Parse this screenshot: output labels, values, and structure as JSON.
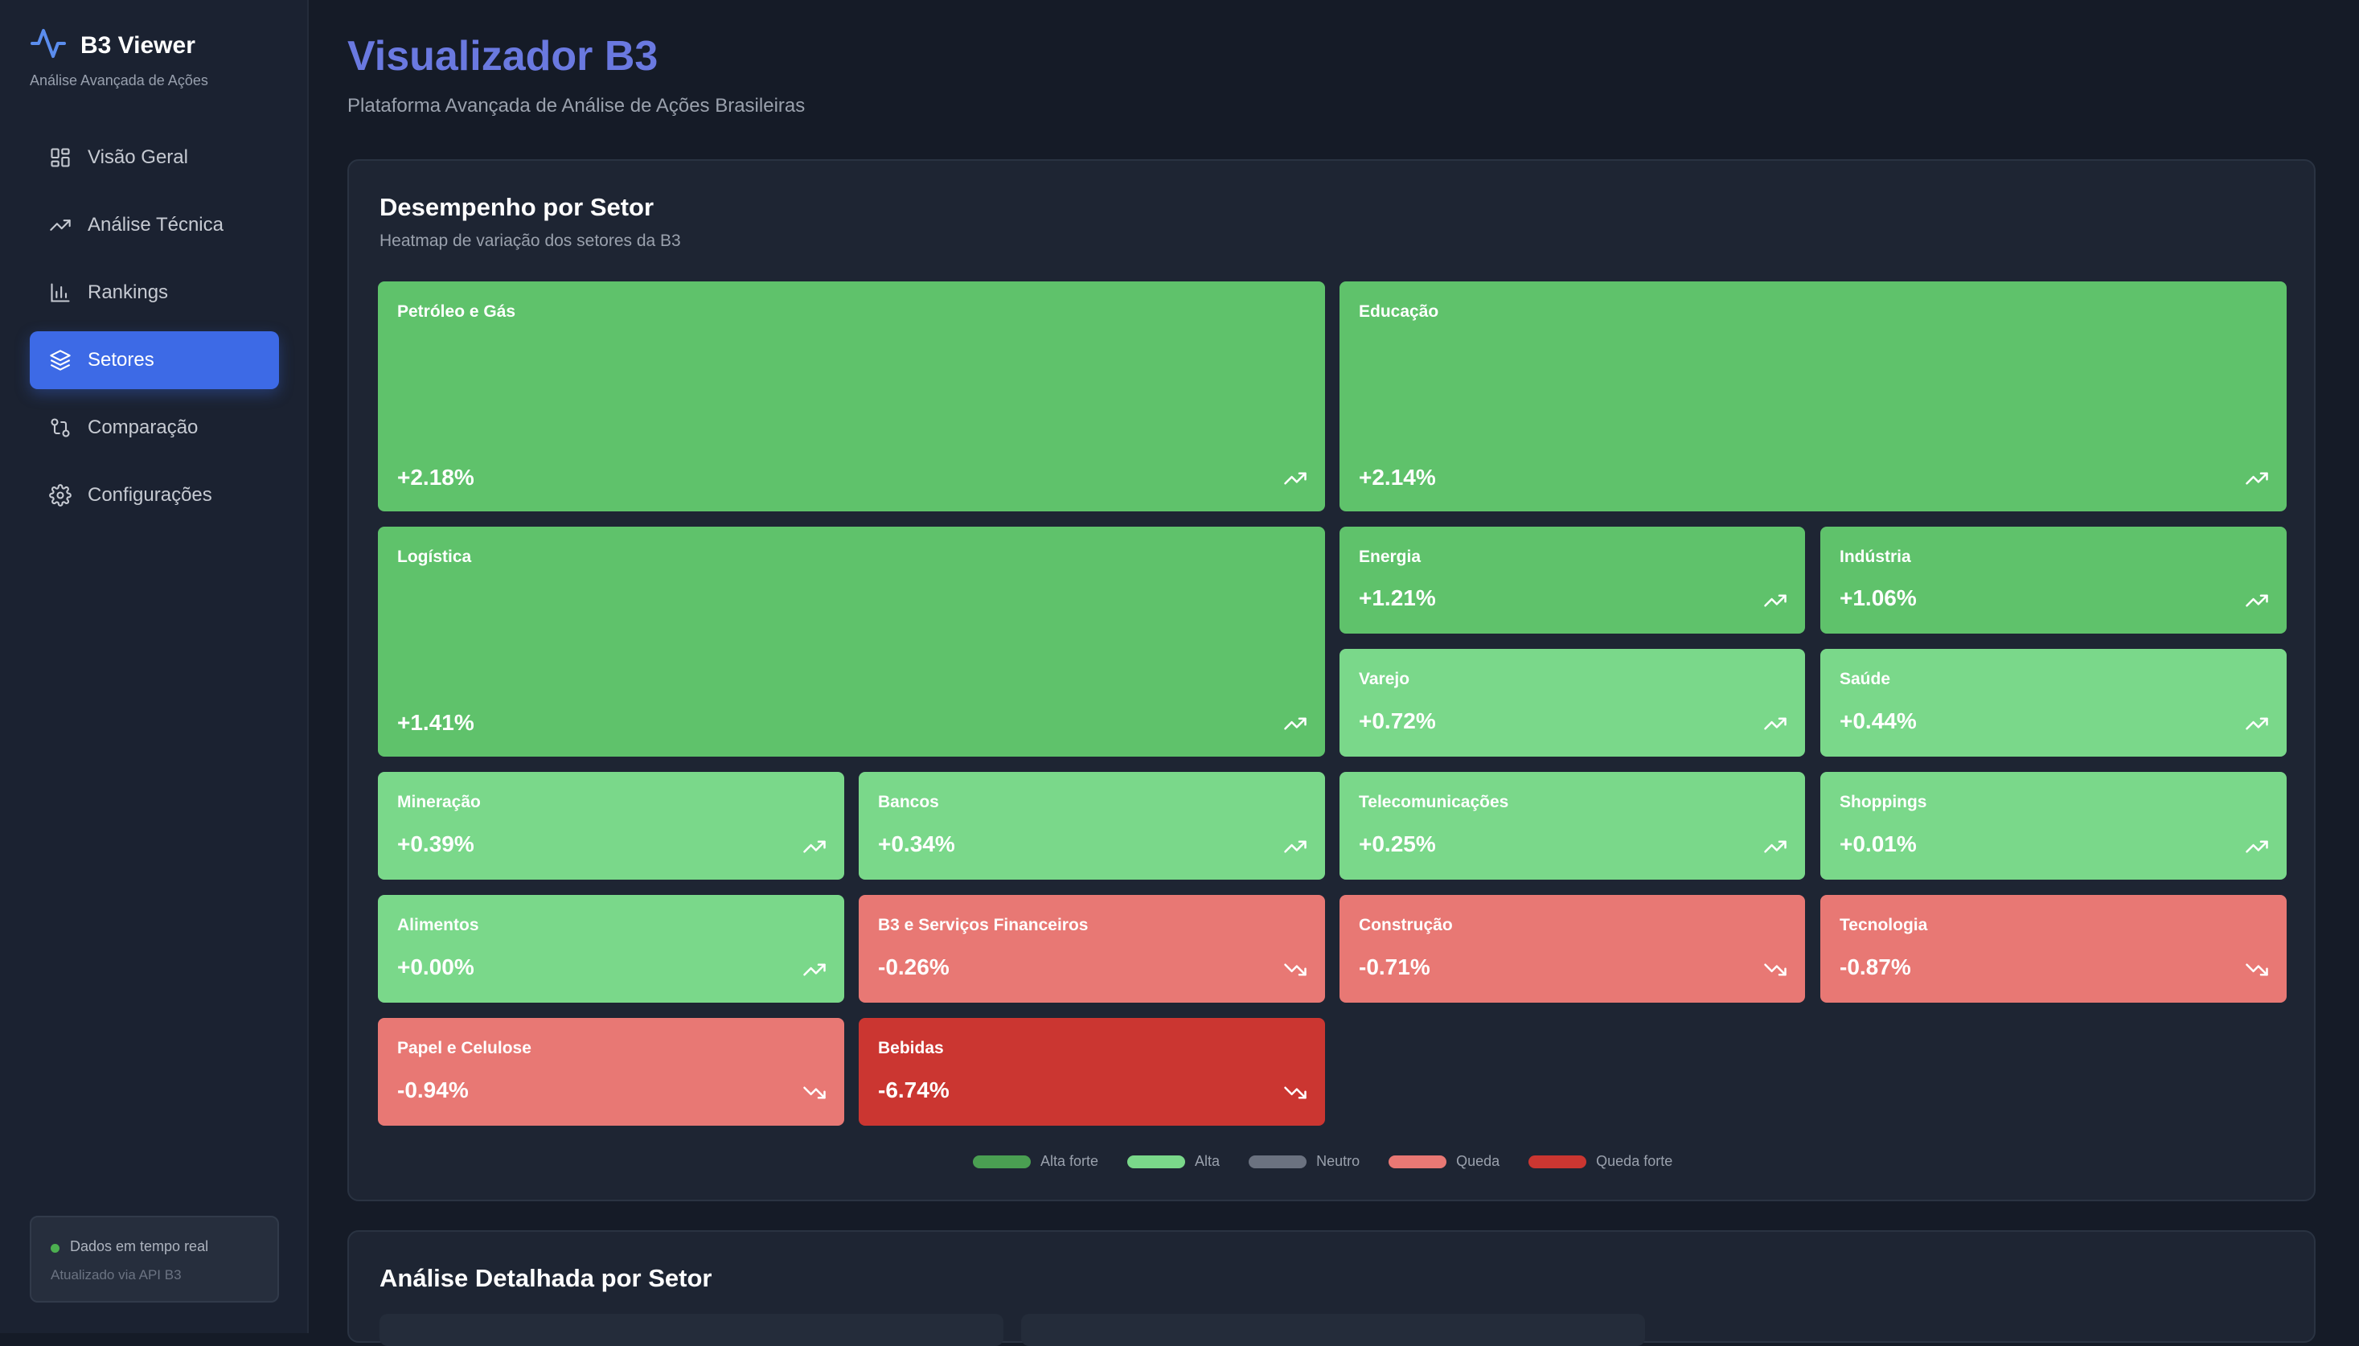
{
  "brand": {
    "title": "B3 Viewer",
    "subtitle": "Análise Avançada de Ações",
    "icon": "activity-pulse-icon"
  },
  "nav": [
    {
      "label": "Visão Geral",
      "icon": "dashboard-grid-icon",
      "active": false
    },
    {
      "label": "Análise Técnica",
      "icon": "trending-up-icon",
      "active": false
    },
    {
      "label": "Rankings",
      "icon": "bar-chart-icon",
      "active": false
    },
    {
      "label": "Setores",
      "icon": "layers-icon",
      "active": true
    },
    {
      "label": "Comparação",
      "icon": "git-compare-icon",
      "active": false
    },
    {
      "label": "Configurações",
      "icon": "gear-icon",
      "active": false
    }
  ],
  "status": {
    "label": "Dados em tempo real",
    "sub": "Atualizado via API B3",
    "color": "#4caf50"
  },
  "page": {
    "title": "Visualizador B3",
    "subtitle": "Plataforma Avançada de Análise de Ações Brasileiras"
  },
  "heatmap": {
    "title": "Desempenho por Setor",
    "subtitle": "Heatmap de variação dos setores da B3",
    "sectors": [
      {
        "name": "Petróleo e Gás",
        "change": "+2.18%",
        "direction": "up",
        "level": "alta-forte"
      },
      {
        "name": "Educação",
        "change": "+2.14%",
        "direction": "up",
        "level": "alta-forte"
      },
      {
        "name": "Logística",
        "change": "+1.41%",
        "direction": "up",
        "level": "alta-forte"
      },
      {
        "name": "Energia",
        "change": "+1.21%",
        "direction": "up",
        "level": "alta-forte"
      },
      {
        "name": "Indústria",
        "change": "+1.06%",
        "direction": "up",
        "level": "alta-forte"
      },
      {
        "name": "Varejo",
        "change": "+0.72%",
        "direction": "up",
        "level": "alta"
      },
      {
        "name": "Saúde",
        "change": "+0.44%",
        "direction": "up",
        "level": "alta"
      },
      {
        "name": "Mineração",
        "change": "+0.39%",
        "direction": "up",
        "level": "alta"
      },
      {
        "name": "Bancos",
        "change": "+0.34%",
        "direction": "up",
        "level": "alta"
      },
      {
        "name": "Telecomunicações",
        "change": "+0.25%",
        "direction": "up",
        "level": "alta"
      },
      {
        "name": "Shoppings",
        "change": "+0.01%",
        "direction": "up",
        "level": "alta"
      },
      {
        "name": "Alimentos",
        "change": "+0.00%",
        "direction": "up",
        "level": "alta"
      },
      {
        "name": "B3 e Serviços Financeiros",
        "change": "-0.26%",
        "direction": "down",
        "level": "queda"
      },
      {
        "name": "Construção",
        "change": "-0.71%",
        "direction": "down",
        "level": "queda"
      },
      {
        "name": "Tecnologia",
        "change": "-0.87%",
        "direction": "down",
        "level": "queda"
      },
      {
        "name": "Papel e Celulose",
        "change": "-0.94%",
        "direction": "down",
        "level": "queda"
      },
      {
        "name": "Bebidas",
        "change": "-6.74%",
        "direction": "down",
        "level": "queda-forte"
      }
    ],
    "legend": [
      {
        "label": "Alta forte",
        "color": "#4a9f52"
      },
      {
        "label": "Alta",
        "color": "#7ad88a"
      },
      {
        "label": "Neutro",
        "color": "#6b7280"
      },
      {
        "label": "Queda",
        "color": "#e87874"
      },
      {
        "label": "Queda forte",
        "color": "#cb3631"
      }
    ],
    "level_colors": {
      "alta-forte": "#5fc26b",
      "alta": "#7ad88a",
      "queda": "#e87874",
      "queda-forte": "#cb3631"
    }
  },
  "detail": {
    "title": "Análise Detalhada por Setor"
  }
}
